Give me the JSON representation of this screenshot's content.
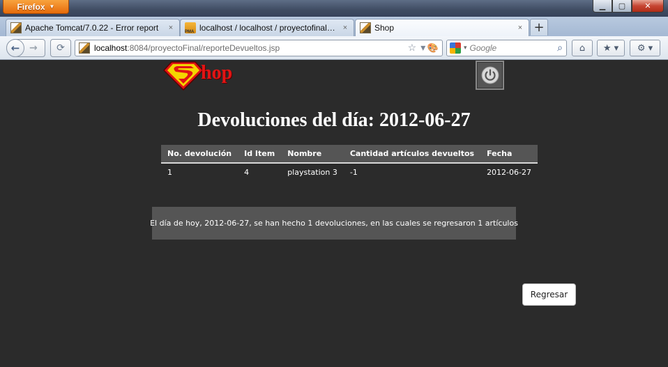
{
  "browser": {
    "menu_button_label": "Firefox",
    "tabs": [
      {
        "title": "Apache Tomcat/7.0.22 - Error report",
        "active": false
      },
      {
        "title": "localhost / localhost / proyectofinal /...",
        "active": false
      },
      {
        "title": "Shop",
        "active": true
      }
    ],
    "new_tab_label": "+",
    "close_tab_glyph": "×",
    "url": {
      "host": "localhost",
      "rest": ":8084/proyectoFinal/reporteDevueltos.jsp"
    },
    "search_placeholder": "Google"
  },
  "page": {
    "logo_text": "hop",
    "title": "Devoluciones del día: 2012-06-27",
    "table": {
      "headers": [
        "No. devolución",
        "Id Item",
        "Nombre",
        "Cantidad artículos devueltos",
        "Fecha"
      ],
      "rows": [
        [
          "1",
          "4",
          "playstation 3",
          "-1",
          "2012-06-27"
        ]
      ]
    },
    "summary": "El día de hoy, 2012-06-27, se han hecho 1 devoluciones, en las cuales se regresaron 1 artículos",
    "back_button_label": "Regresar"
  },
  "colors": {
    "page_background": "#2b2b2b",
    "panel_background": "#555555",
    "logo_red": "#e21414",
    "logo_yellow": "#f5d500"
  }
}
